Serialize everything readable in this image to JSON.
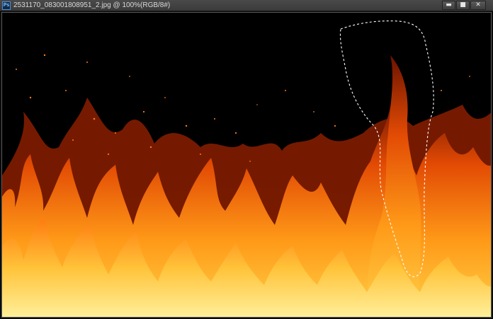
{
  "window": {
    "app_icon": "ps-icon",
    "app_icon_text": "Ps",
    "title": "2531170_083001808951_2.jpg @ 100%(RGB/8#)",
    "controls": {
      "minimize": "▬",
      "maximize": "■",
      "close": "✕"
    }
  },
  "canvas": {
    "image_description_icon": "fire-image",
    "selection": "marquee-selection"
  },
  "colors": {
    "flame_core": "#ffd24a",
    "flame_mid": "#ff7a10",
    "flame_outer": "#c22a00",
    "background": "#000000"
  }
}
